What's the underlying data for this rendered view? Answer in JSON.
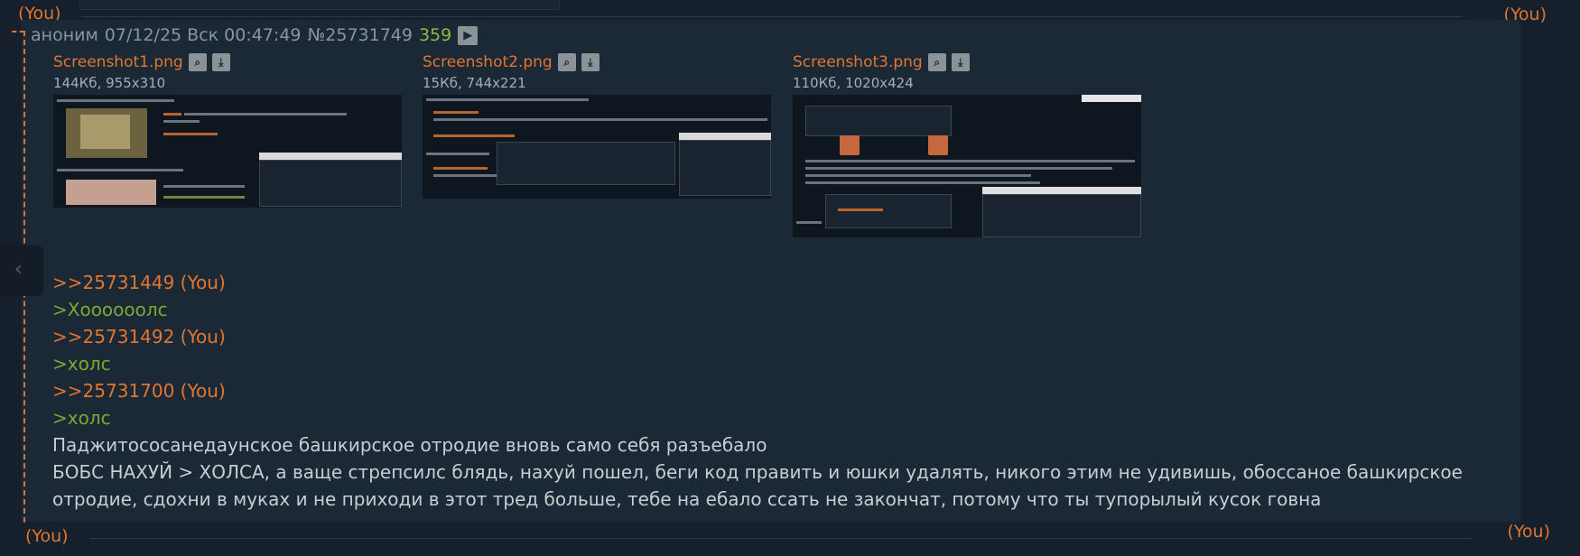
{
  "you_label": "(You)",
  "post": {
    "author": "аноним",
    "date": "07/12/25 Вск 00:47:49",
    "number": "№25731749",
    "reply_count": "359",
    "play_icon": "play-icon"
  },
  "files": [
    {
      "name": "Screenshot1.png",
      "meta": "144Кб, 955x310"
    },
    {
      "name": "Screenshot2.png",
      "meta": "15Кб, 744x221"
    },
    {
      "name": "Screenshot3.png",
      "meta": "110Кб, 1020x424"
    }
  ],
  "body": {
    "line1": ">>25731449",
    "line1_you": "(You)",
    "line2": ">Хоооооолс",
    "line3": ">>25731492",
    "line3_you": "(You)",
    "line4": ">холс",
    "line5": ">>25731700",
    "line5_you": "(You)",
    "line6": ">холс",
    "line7": "Паджитососанедаунское башкирское отродие вновь само себя разъебало",
    "line8": "БОБС НАХУЙ > ХОЛСА, а ваще стрепсилс блядь, нахуй пошел, беги код править и юшки удалять, никого этим не удивишь, обоссаное башкирское отродие, сдохни в муках и не приходи в этот тред больше, тебе на ебало ссать не закончат, потому что ты тупорылый кусок говна"
  }
}
